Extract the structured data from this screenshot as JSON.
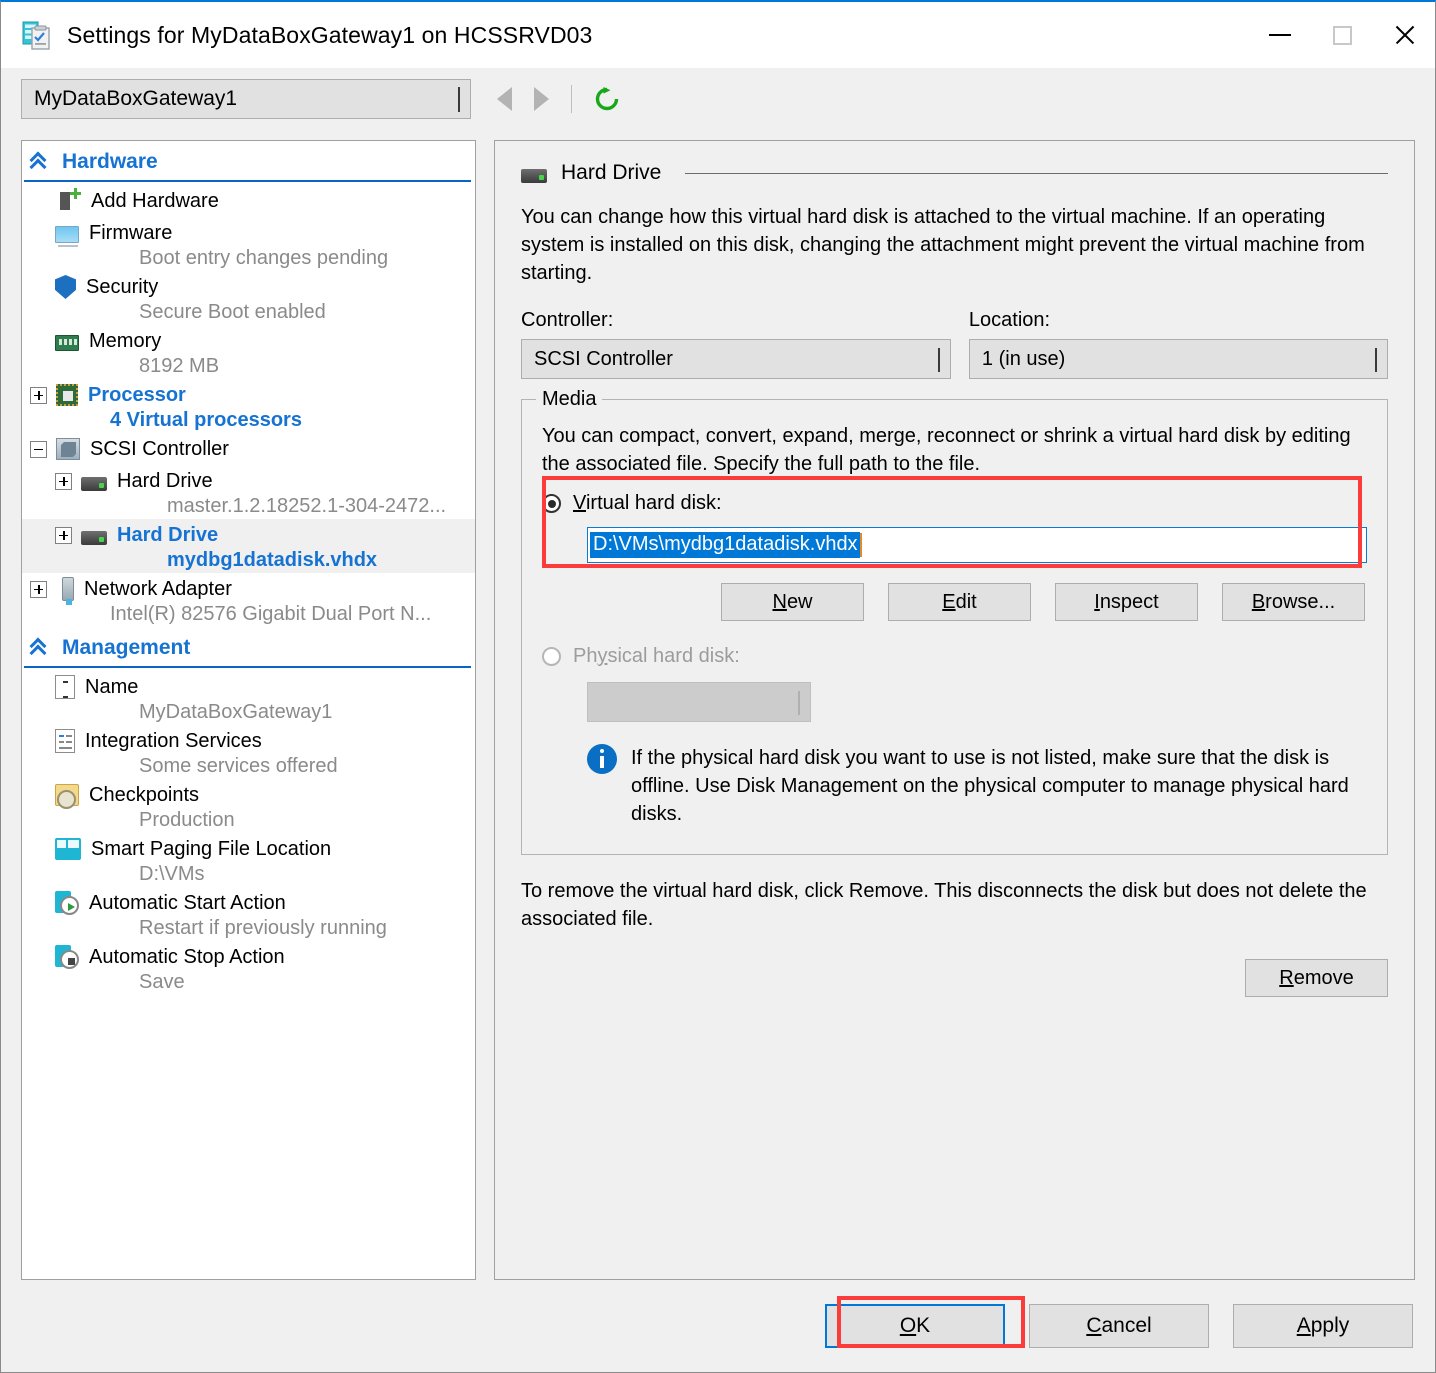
{
  "window": {
    "title": "Settings for MyDataBoxGateway1 on HCSSRVD03",
    "icon": "vm-settings-icon",
    "controls": {
      "minimize": "minimize-icon",
      "maximize": "maximize-icon",
      "close": "close-icon"
    }
  },
  "toolbar": {
    "vm_selector_value": "MyDataBoxGateway1",
    "back": "back-arrow-icon",
    "forward": "forward-arrow-icon",
    "refresh": "refresh-icon"
  },
  "sidebar": {
    "groups": [
      {
        "label": "Hardware",
        "items": [
          {
            "label": "Add Hardware",
            "sub": "",
            "icon": "add-hardware-icon",
            "expander": "none",
            "selected": false,
            "indent": 1
          },
          {
            "label": "Firmware",
            "sub": "Boot entry changes pending",
            "icon": "firmware-icon",
            "expander": "none",
            "selected": false,
            "indent": 1
          },
          {
            "label": "Security",
            "sub": "Secure Boot enabled",
            "icon": "security-shield-icon",
            "expander": "none",
            "selected": false,
            "indent": 1
          },
          {
            "label": "Memory",
            "sub": "8192 MB",
            "icon": "memory-icon",
            "expander": "none",
            "selected": false,
            "indent": 1
          },
          {
            "label": "Processor",
            "sub": "4 Virtual processors",
            "icon": "processor-icon",
            "expander": "plus",
            "selected": false,
            "indent": 0,
            "link": true
          },
          {
            "label": "SCSI Controller",
            "sub": "",
            "icon": "scsi-controller-icon",
            "expander": "minus",
            "selected": false,
            "indent": 0
          },
          {
            "label": "Hard Drive",
            "sub": "master.1.2.18252.1-304-2472...",
            "icon": "hard-drive-icon",
            "expander": "plus",
            "selected": false,
            "indent": 1
          },
          {
            "label": "Hard Drive",
            "sub": "mydbg1datadisk.vhdx",
            "icon": "hard-drive-icon",
            "expander": "plus",
            "selected": true,
            "indent": 1,
            "link": true
          },
          {
            "label": "Network Adapter",
            "sub": "Intel(R) 82576 Gigabit Dual Port N...",
            "icon": "network-adapter-icon",
            "expander": "plus",
            "selected": false,
            "indent": 0
          }
        ]
      },
      {
        "label": "Management",
        "items": [
          {
            "label": "Name",
            "sub": "MyDataBoxGateway1",
            "icon": "name-icon",
            "expander": "none",
            "selected": false,
            "indent": 1
          },
          {
            "label": "Integration Services",
            "sub": "Some services offered",
            "icon": "integration-services-icon",
            "expander": "none",
            "selected": false,
            "indent": 1
          },
          {
            "label": "Checkpoints",
            "sub": "Production",
            "icon": "checkpoints-icon",
            "expander": "none",
            "selected": false,
            "indent": 1
          },
          {
            "label": "Smart Paging File Location",
            "sub": "D:\\VMs",
            "icon": "smart-paging-icon",
            "expander": "none",
            "selected": false,
            "indent": 1
          },
          {
            "label": "Automatic Start Action",
            "sub": "Restart if previously running",
            "icon": "auto-start-icon",
            "expander": "none",
            "selected": false,
            "indent": 1
          },
          {
            "label": "Automatic Stop Action",
            "sub": "Save",
            "icon": "auto-stop-icon",
            "expander": "none",
            "selected": false,
            "indent": 1
          }
        ]
      }
    ]
  },
  "panel": {
    "title": "Hard Drive",
    "icon": "hard-drive-icon",
    "description": "You can change how this virtual hard disk is attached to the virtual machine. If an operating system is installed on this disk, changing the attachment might prevent the virtual machine from starting.",
    "controller_label": "Controller:",
    "controller_value": "SCSI Controller",
    "location_label": "Location:",
    "location_value": "1 (in use)",
    "media": {
      "title": "Media",
      "description": "You can compact, convert, expand, merge, reconnect or shrink a virtual hard disk by editing the associated file. Specify the full path to the file.",
      "virtual_label": "Virtual hard disk:",
      "virtual_path": "D:\\VMs\\mydbg1datadisk.vhdx",
      "buttons": {
        "new": "New",
        "edit": "Edit",
        "inspect": "Inspect",
        "browse": "Browse..."
      },
      "physical_label": "Physical hard disk:",
      "physical_value": "",
      "info_icon": "info-icon",
      "info_text": "If the physical hard disk you want to use is not listed, make sure that the disk is offline. Use Disk Management on the physical computer to manage physical hard disks."
    },
    "remove_note": "To remove the virtual hard disk, click Remove. This disconnects the disk but does not delete the associated file.",
    "remove_button": "Remove"
  },
  "footer": {
    "ok": "OK",
    "cancel": "Cancel",
    "apply": "Apply"
  },
  "colors": {
    "accent": "#0078d7",
    "link": "#1673d2",
    "annotation": "#fc3b3b",
    "selection": "#0078d7",
    "subtext": "#8a8a8a"
  }
}
